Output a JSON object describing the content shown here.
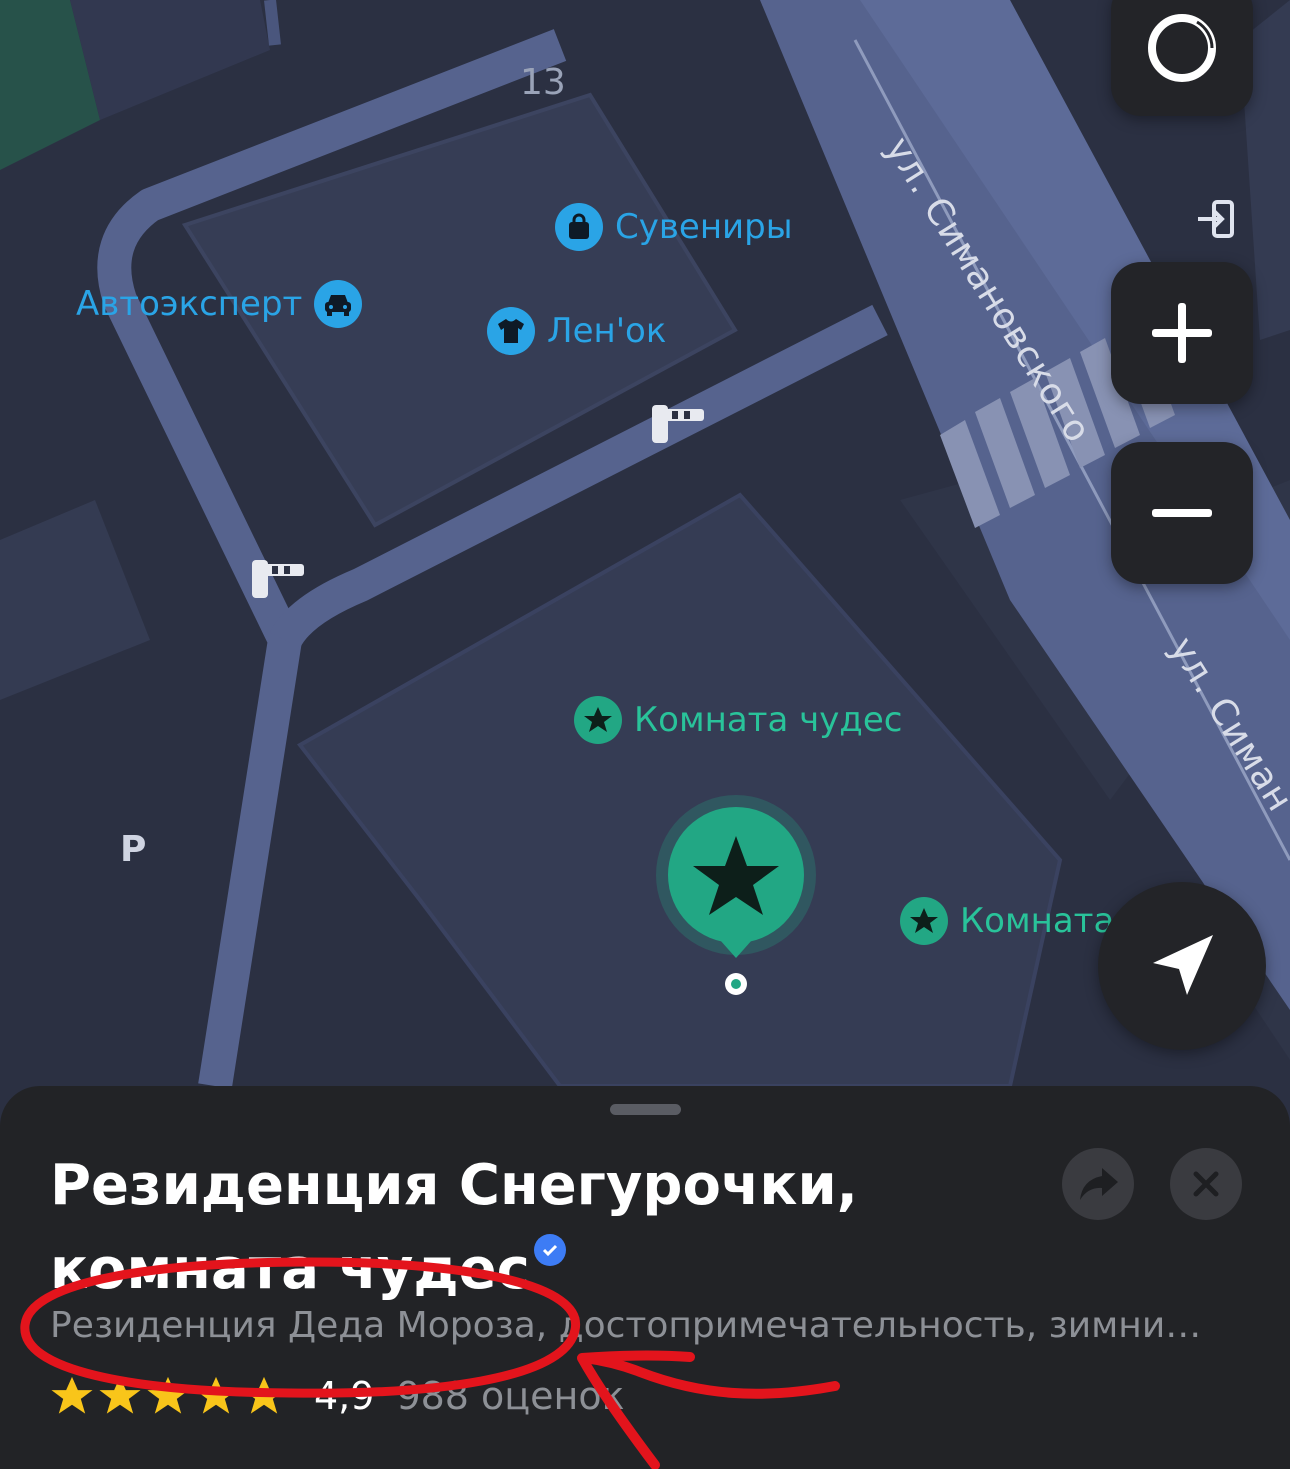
{
  "map": {
    "building_number": "13",
    "parking_label": "P",
    "street_main": "ул. Симановского",
    "street_secondary": "ул. Симан",
    "pois": [
      {
        "label": "Сувениры",
        "icon": "shopping-bag-icon",
        "color": "#2aa4e6"
      },
      {
        "label": "Автоэксперт",
        "icon": "car-icon",
        "color": "#2aa4e6"
      },
      {
        "label": "Лен'ок",
        "icon": "tshirt-icon",
        "color": "#2aa4e6"
      },
      {
        "label": "Комната чудес",
        "icon": "star-icon",
        "color": "#29c39a"
      },
      {
        "label": "Комната",
        "icon": "star-icon",
        "color": "#29c39a"
      }
    ],
    "selected_pin_icon": "star-icon",
    "barrier_icon": "barrier-gate-icon",
    "entrance_icon": "entrance-icon"
  },
  "controls": {
    "assistant_icon": "alice-ring-icon",
    "zoom_in_icon": "plus-icon",
    "zoom_out_icon": "minus-icon",
    "locate_icon": "navigation-arrow-icon"
  },
  "place": {
    "title": "Резиденция Снегурочки, комната чудес",
    "verified_icon": "verified-check-icon",
    "share_icon": "share-arrow-icon",
    "close_icon": "close-icon",
    "subtitle": "Резиденция Деда Мороза, достопримечательность, зимни…",
    "rating_value": "4,9",
    "rating_count": "988 оценок",
    "stars": 5,
    "star_color": "#f9c51a"
  },
  "colors": {
    "accent_green": "#22a784",
    "accent_blue": "#2aa4e6",
    "annotation_red": "#e3141c"
  }
}
